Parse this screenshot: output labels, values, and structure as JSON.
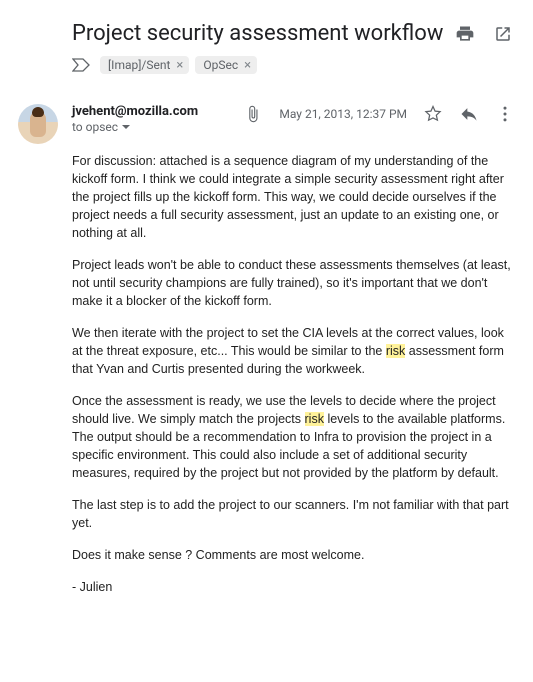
{
  "subject": "Project security assessment workflow",
  "labels": [
    {
      "name": "[Imap]/Sent"
    },
    {
      "name": "OpSec"
    }
  ],
  "message": {
    "sender": "jvehent@mozilla.com",
    "recipients": "to opsec",
    "date": "May 21, 2013, 12:37 PM",
    "highlight_term": "risk",
    "paragraphs": [
      "For discussion: attached is a sequence diagram of my understanding of the kickoff form. I think we could integrate a simple security assessment right after the project fills up the kickoff form. This way, we could decide ourselves if the project needs a full security assessment, just an update to an existing one, or nothing at all.",
      "Project leads won't be able to conduct these assessments themselves (at least, not until security champions are fully trained), so it's important that we don't make it a blocker of the kickoff form.",
      "We then iterate with the project to set the CIA levels at the correct values, look at the threat exposure, etc... This would be similar to the risk assessment form that Yvan and Curtis presented during the workweek.",
      "Once the assessment is ready, we use the levels to decide where the project should live. We simply match the projects risk levels to the available platforms. The output should be a recommendation to Infra to provision the project in a specific environment. This could also include a set of additional security measures, required by the project but not provided by the platform by default.",
      "The last step is to add the project to our scanners. I'm not familiar with that part yet.",
      "Does it make sense ? Comments are most welcome.",
      "- Julien"
    ]
  }
}
